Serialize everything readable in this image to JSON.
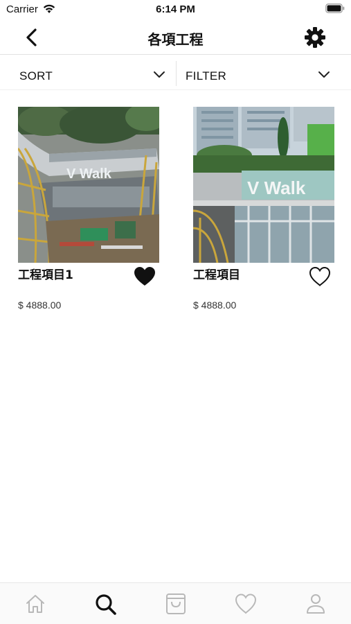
{
  "status_bar": {
    "carrier": "Carrier",
    "time": "6:14 PM",
    "icons": [
      "wifi-icon",
      "battery-icon"
    ]
  },
  "nav": {
    "title": "各項工程",
    "back_icon": "chevron-left-icon",
    "settings_icon": "gear-icon"
  },
  "toolbar": {
    "sort_label": "SORT",
    "filter_label": "FILTER"
  },
  "products": [
    {
      "name": "工程項目1",
      "price": "$ 4888.00",
      "favorited": true
    },
    {
      "name": "工程項目",
      "price": "$ 4888.00",
      "favorited": false
    }
  ],
  "tabs": [
    {
      "icon": "home-icon",
      "active": false
    },
    {
      "icon": "search-icon",
      "active": true
    },
    {
      "icon": "shopping-bag-icon",
      "active": false
    },
    {
      "icon": "heart-icon",
      "active": false
    },
    {
      "icon": "user-icon",
      "active": false
    }
  ],
  "colors": {
    "active_tab": "#111111",
    "inactive_tab": "#b8b8b8",
    "text": "#111111"
  }
}
